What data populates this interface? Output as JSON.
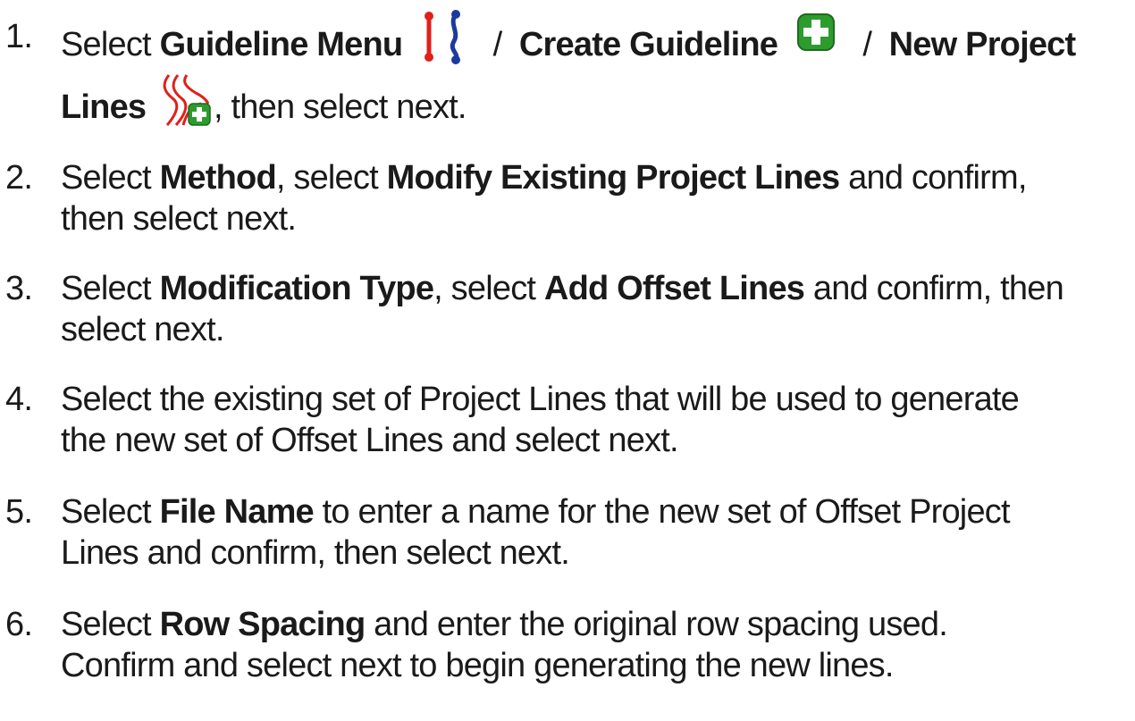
{
  "steps": [
    {
      "number": "1.",
      "select": "Select",
      "guideline_menu": "Guideline Menu",
      "slash1": " / ",
      "create_guideline": "Create Guideline",
      "slash2": " / ",
      "new_project": "New Project",
      "lines": "Lines",
      "tail": ", then select next.",
      "icons": [
        "guideline-menu-icon",
        "create-guideline-icon",
        "new-project-lines-icon"
      ]
    },
    {
      "number": "2.",
      "t1": "Select ",
      "b1": "Method",
      "t2": ", select ",
      "b2": "Modify Existing Project Lines",
      "t3": " and confirm,",
      "t4": "then select next."
    },
    {
      "number": "3.",
      "t1": "Select ",
      "b1": "Modification Type",
      "t2": ", select ",
      "b2": "Add Offset Lines",
      "t3": " and confirm, then",
      "t4": "select next."
    },
    {
      "number": "4.",
      "t1": "Select the existing set of Project Lines that will be used to generate",
      "t2": "the new set of Offset Lines and select next."
    },
    {
      "number": "5.",
      "t1": "Select ",
      "b1": "File Name",
      "t2": " to enter a name for the new set of Offset Project",
      "t3": "Lines and confirm, then select next."
    },
    {
      "number": "6.",
      "t1": "Select ",
      "b1": "Row Spacing",
      "t2": " and enter the original row spacing used.",
      "t3": "Confirm and select next to begin generating the new lines."
    }
  ],
  "colors": {
    "text": "#1a1a1a",
    "icon_red": "#e0201a",
    "icon_blue": "#1c3a9e",
    "icon_green": "#2e9b2e"
  }
}
